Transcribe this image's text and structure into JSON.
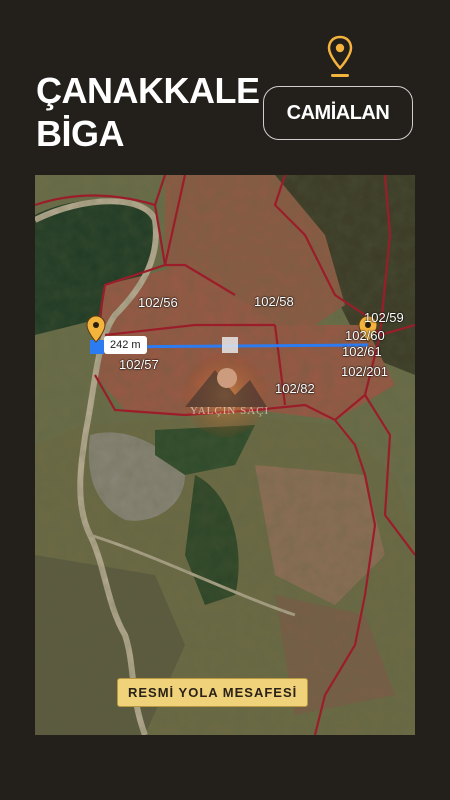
{
  "header": {
    "title_line1": "ÇANAKKALE",
    "title_line2": "BİGA",
    "location_badge": "CAMİALAN",
    "pin_icon": "location-pin-icon",
    "accent_color": "#f3b33d"
  },
  "map": {
    "type": "satellite",
    "parcels": [
      "102/56",
      "102/58",
      "102/59",
      "102/60",
      "102/61",
      "102/57",
      "102/201",
      "102/82"
    ],
    "parcel_border_color": "#9b1d2a",
    "measurement": {
      "distance_label": "242 m",
      "line_color": "#2d7bf0"
    },
    "watermark": "YALÇIN SAÇI",
    "caption": "RESMİ YOLA MESAFESİ"
  }
}
